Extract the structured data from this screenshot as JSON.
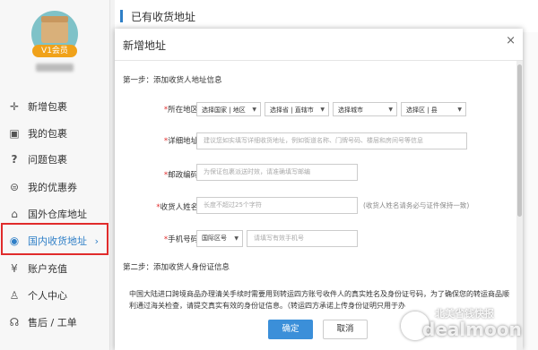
{
  "sidebar": {
    "vip_badge": "V1会员",
    "items": [
      {
        "label": "新增包裹",
        "icon": "plus-icon"
      },
      {
        "label": "我的包裹",
        "icon": "gift-box-icon"
      },
      {
        "label": "问题包裹",
        "icon": "question-icon"
      },
      {
        "label": "我的优惠券",
        "icon": "coupon-icon"
      },
      {
        "label": "国外仓库地址",
        "icon": "warehouse-icon"
      },
      {
        "label": "国内收货地址",
        "icon": "location-pin-icon",
        "active": true
      },
      {
        "label": "账户充值",
        "icon": "yen-icon"
      },
      {
        "label": "个人中心",
        "icon": "user-icon"
      },
      {
        "label": "售后 / 工单",
        "icon": "headset-icon"
      }
    ]
  },
  "header": {
    "title": "已有收货地址"
  },
  "modal": {
    "title": "新增地址",
    "close_symbol": "×",
    "step1": "第一步：添加收货人地址信息",
    "step2": "第二步：添加收货人身份证信息",
    "region_label": "所在地区:",
    "region_selects": [
      "选择国家 | 地区",
      "选择省 | 直辖市",
      "选择城市",
      "选择区 | 县"
    ],
    "address_label": "详细地址:",
    "address_placeholder": "建议您如实填写详细收货地址，例如街道名称、门牌号码、楼层和房间号等信息",
    "postal_label": "邮政编码:",
    "postal_placeholder": "为保证包裹派送时效，请准确填写邮编",
    "name_label": "收货人姓名:",
    "name_placeholder": "长度不超过25个字符",
    "name_hint": "(收货人姓名请务必与证件保持一致)",
    "phone_label": "手机号码:",
    "phone_region": "国际区号",
    "phone_placeholder": "请填写有效手机号",
    "notice": "中国大陆进口跨境商品办理清关手续时需要用到转运四方账号收件人的真实姓名及身份证号码，为了确保您的转运商品顺利通过海关检查，请提交真实有效的身份证信息。（转运四方承诺上传身份证明只用于办",
    "ok_button": "确定",
    "cancel_button": "取消"
  },
  "watermark": {
    "cn": "北美省钱快报",
    "en": "dealmoon"
  },
  "colors": {
    "accent": "#2f7fc7",
    "highlight_border": "#e02b2b",
    "ok_button": "#3b8fd9"
  }
}
